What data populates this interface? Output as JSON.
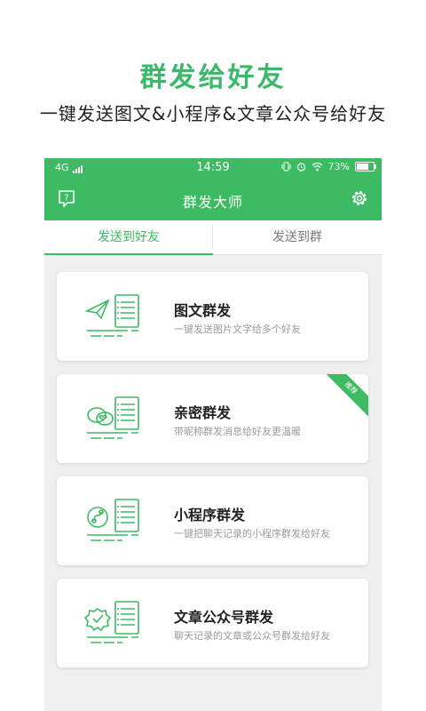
{
  "promo": {
    "title": "群发给好友",
    "subtitle": "一键发送图文&小程序&文章公众号给好友"
  },
  "status_bar": {
    "network": "4G",
    "time": "14:59",
    "battery": "73%",
    "battery_level": 0.73,
    "icons": [
      "signal-icon",
      "vibrate-icon",
      "alarm-icon",
      "wifi-icon",
      "battery-icon"
    ]
  },
  "app_bar": {
    "title": "群发大师",
    "left_icon": "help-icon",
    "right_icon": "gear-icon"
  },
  "tabs": [
    {
      "label": "发送到好友",
      "active": true
    },
    {
      "label": "发送到群",
      "active": false
    }
  ],
  "cards": [
    {
      "title": "图文群发",
      "subtitle": "一键发送图片文字给多个好友",
      "icon": "paper-plane-icon"
    },
    {
      "title": "亲密群发",
      "subtitle": "带昵称群发消息给好友更温暖",
      "icon": "chat-bubbles-icon",
      "badge": "推荐"
    },
    {
      "title": "小程序群发",
      "subtitle": "一键把聊天记录的小程序群发给好友",
      "icon": "mini-program-icon"
    },
    {
      "title": "文章公众号群发",
      "subtitle": "聊天记录的文章或公众号群发给好友",
      "icon": "verified-badge-icon"
    }
  ],
  "colors": {
    "accent": "#3cbb62",
    "promo_title": "#3cb86a",
    "background": "#efefef"
  }
}
